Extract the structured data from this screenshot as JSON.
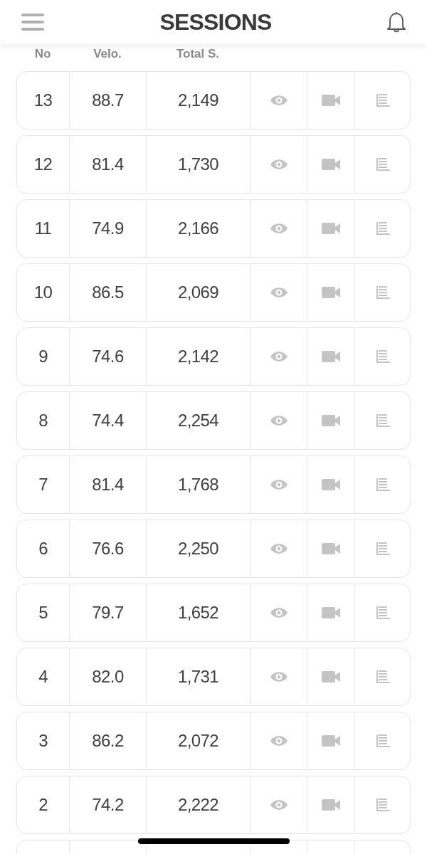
{
  "header": {
    "title": "SESSIONS"
  },
  "columns": [
    "No",
    "Velo.",
    "Total S."
  ],
  "rows": [
    {
      "no": "13",
      "velo": "88.7",
      "total": "2,149"
    },
    {
      "no": "12",
      "velo": "81.4",
      "total": "1,730"
    },
    {
      "no": "11",
      "velo": "74.9",
      "total": "2,166"
    },
    {
      "no": "10",
      "velo": "86.5",
      "total": "2,069"
    },
    {
      "no": "9",
      "velo": "74.6",
      "total": "2,142"
    },
    {
      "no": "8",
      "velo": "74.4",
      "total": "2,254"
    },
    {
      "no": "7",
      "velo": "81.4",
      "total": "1,768"
    },
    {
      "no": "6",
      "velo": "76.6",
      "total": "2,250"
    },
    {
      "no": "5",
      "velo": "79.7",
      "total": "1,652"
    },
    {
      "no": "4",
      "velo": "82.0",
      "total": "1,731"
    },
    {
      "no": "3",
      "velo": "86.2",
      "total": "2,072"
    },
    {
      "no": "2",
      "velo": "74.2",
      "total": "2,222"
    }
  ]
}
